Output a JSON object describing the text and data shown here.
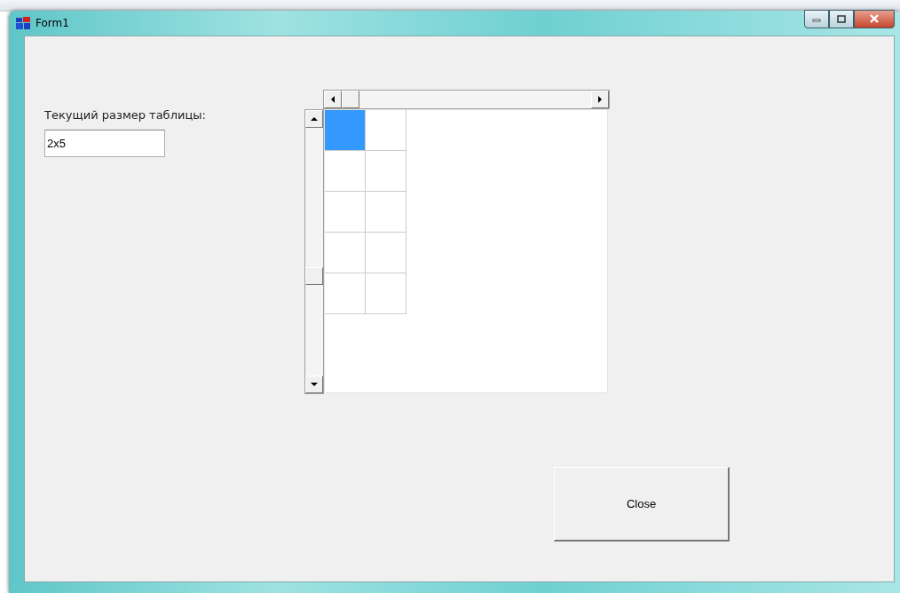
{
  "window": {
    "title": "Form1"
  },
  "size_label": "Текущий размер таблицы:",
  "size_field": {
    "value": "2x5"
  },
  "grid": {
    "rows": [
      [
        {
          "selected": true
        },
        {
          "selected": false
        }
      ],
      [
        {
          "selected": false
        },
        {
          "selected": false
        }
      ],
      [
        {
          "selected": false
        },
        {
          "selected": false
        }
      ],
      [
        {
          "selected": false
        },
        {
          "selected": false
        }
      ],
      [
        {
          "selected": false
        },
        {
          "selected": false
        }
      ]
    ]
  },
  "close_button": {
    "label": "Close"
  }
}
